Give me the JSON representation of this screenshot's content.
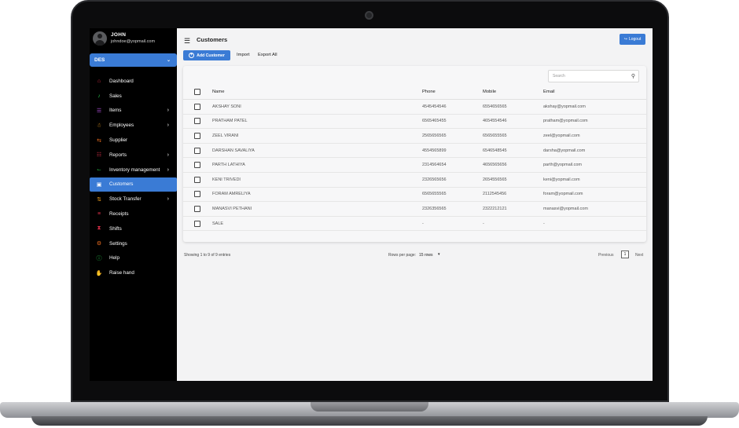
{
  "user": {
    "name": "JOHN",
    "email": "johndoe@yopmail.com"
  },
  "store_selector": {
    "value": "DES"
  },
  "sidebar": {
    "items": [
      {
        "label": "Dashboard",
        "icon": "home-icon",
        "color": "#e0304a",
        "arrow": false,
        "active": false
      },
      {
        "label": "Sales",
        "icon": "bell-icon",
        "color": "#27c04a",
        "arrow": false,
        "active": false
      },
      {
        "label": "Items",
        "icon": "items-icon",
        "color": "#b552e0",
        "arrow": true,
        "active": false
      },
      {
        "label": "Employees",
        "icon": "employee-icon",
        "color": "#f0a020",
        "arrow": true,
        "active": false
      },
      {
        "label": "Supplier",
        "icon": "transfer-icon",
        "color": "#f07020",
        "arrow": false,
        "active": false
      },
      {
        "label": "Reports",
        "icon": "report-icon",
        "color": "#e0304a",
        "arrow": true,
        "active": false
      },
      {
        "label": "Inventory management",
        "icon": "cart-icon",
        "color": "#27c04a",
        "arrow": true,
        "active": false
      },
      {
        "label": "Customers",
        "icon": "customers-icon",
        "color": "#b552e0",
        "arrow": false,
        "active": true
      },
      {
        "label": "Stock Transfer",
        "icon": "swap-icon",
        "color": "#f0a020",
        "arrow": true,
        "active": false
      },
      {
        "label": "Receipts",
        "icon": "receipt-icon",
        "color": "#e0304a",
        "arrow": false,
        "active": false
      },
      {
        "label": "Shifts",
        "icon": "shifts-icon",
        "color": "#e0304a",
        "arrow": false,
        "active": false
      },
      {
        "label": "Settings",
        "icon": "settings-icon",
        "color": "#f07020",
        "arrow": false,
        "active": false
      },
      {
        "label": "Help",
        "icon": "help-icon",
        "color": "#27c04a",
        "arrow": false,
        "active": false
      },
      {
        "label": "Raise hand",
        "icon": "hand-icon",
        "color": "#b552e0",
        "arrow": false,
        "active": false
      }
    ]
  },
  "header": {
    "title": "Customers",
    "logout_label": "Logout"
  },
  "toolbar": {
    "add_label": "Add Customer",
    "import_label": "Import",
    "export_label": "Export All"
  },
  "search": {
    "placeholder": "Search"
  },
  "table": {
    "columns": {
      "name": "Name",
      "phone": "Phone",
      "mobile": "Mobile",
      "email": "Email"
    },
    "rows": [
      {
        "name": "AKSHAY SONI",
        "phone": "4545454546",
        "mobile": "6554656565",
        "email": "akshay@yopmail.com"
      },
      {
        "name": "PRATHAM PATEL",
        "phone": "6565465455",
        "mobile": "4654554546",
        "email": "pratham@yopmail.com"
      },
      {
        "name": "ZEEL VIRANI",
        "phone": "2565656565",
        "mobile": "6565655565",
        "email": "zeel@yopmail.com"
      },
      {
        "name": "DARSHAN SAVALIYA",
        "phone": "4554565899",
        "mobile": "6546548545",
        "email": "darsha@yopmail.com"
      },
      {
        "name": "PARTH LATHIYA",
        "phone": "2314564654",
        "mobile": "4656565656",
        "email": "parth@yopmail.com"
      },
      {
        "name": "KENI TRIVEDI",
        "phone": "2326565656",
        "mobile": "2654556565",
        "email": "keni@yopmail.com"
      },
      {
        "name": "FORAM AMRELIYA",
        "phone": "6565655565",
        "mobile": "2112545456",
        "email": "foram@yopmail.com"
      },
      {
        "name": "MANASVI PETHANI",
        "phone": "2326356565",
        "mobile": "2322212121",
        "email": "manasvi@yopmail.com"
      },
      {
        "name": "SALE",
        "phone": "-",
        "mobile": "-",
        "email": "-"
      }
    ]
  },
  "footer": {
    "entries_text": "Showing 1 to 9 of 9 entries",
    "rows_per_page_label": "Rows per page:",
    "rows_per_page_value": "15 rows",
    "prev_label": "Previous",
    "page": "1",
    "next_label": "Next"
  },
  "colors": {
    "accent": "#3a7bd5",
    "sidebar_bg": "#000000"
  }
}
